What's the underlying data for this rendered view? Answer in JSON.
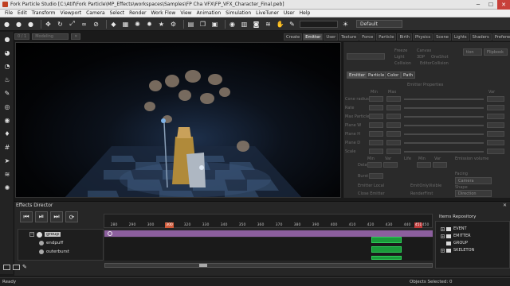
{
  "window": {
    "title": "Fork Particle Studio [C:\\Atif\\Fork Particle\\MP_Effects\\workspaces\\Samples\\FP Cha VFX\\FP_VFX_Character_Final.peb]",
    "minimize": "─",
    "maximize": "☐",
    "close": "✕"
  },
  "menu": [
    "File",
    "Edit",
    "Transform",
    "Viewport",
    "Camera",
    "Select",
    "Render",
    "Work Flow",
    "View",
    "Animation",
    "Simulation",
    "LiveTuner",
    "User",
    "Help"
  ],
  "toolbar": {
    "icons": [
      "blob-icon",
      "blob-icon",
      "blob-icon",
      "move-icon",
      "rotate-icon",
      "scale-icon",
      "link-icon",
      "unlink-icon",
      "shape-icon",
      "grid-icon",
      "burst-icon",
      "explode-icon",
      "star-icon",
      "settings-icon",
      "layers-icon",
      "copy-icon",
      "paste-icon",
      "eye-icon",
      "film-icon",
      "camera-icon",
      "wind-icon",
      "grab-icon",
      "wrench-icon"
    ],
    "preset_selected": "Default"
  },
  "subbar": {
    "frame_field": "0 / 1",
    "mode_select": "Modeling",
    "close_btn": "✕"
  },
  "property_tabs": [
    {
      "label": "Create",
      "active": false
    },
    {
      "label": "Emitter",
      "active": true
    },
    {
      "label": "User",
      "active": false
    },
    {
      "label": "Texture",
      "active": false
    },
    {
      "label": "Force",
      "active": false
    },
    {
      "label": "Particle",
      "active": false
    },
    {
      "label": "Birth",
      "active": false
    },
    {
      "label": "Physics",
      "active": false
    },
    {
      "label": "Scene",
      "active": false
    },
    {
      "label": "Lights",
      "active": false
    },
    {
      "label": "Shaders",
      "active": false
    },
    {
      "label": "Preferences",
      "active": false
    }
  ],
  "panel": {
    "top_buttons": [
      "tion",
      "Flipbook"
    ],
    "checks": [
      "Freeze",
      "Canvas",
      "Light",
      "3DP",
      "OneShot",
      "Collision",
      "EditorCollision"
    ],
    "sub_tabs": [
      "Emitter",
      "Particle",
      "Color",
      "Path"
    ],
    "section_title": "Emitter Properties",
    "col_headers": [
      "Min",
      "Max",
      "Var"
    ],
    "rows": [
      "Cone radius",
      "Rate",
      "Max Particle",
      "Plane W",
      "Plane H",
      "Plane D",
      "Scale"
    ],
    "lower_labels": [
      "Delay",
      "Min",
      "Var",
      "Life",
      "Min",
      "Var",
      "Burst",
      "Emitter Local",
      "EmitOnlyVisible",
      "Close Emitter",
      "RenderFirst"
    ],
    "lower_fields": [
      "Emission volume",
      "Facing",
      "Camera",
      "Shape",
      "Direction"
    ]
  },
  "effects_director": {
    "title": "Effects Director",
    "close": "✕",
    "transport": [
      "⏮",
      "⏯",
      "⏭",
      "⟳"
    ],
    "ruler_ticks": [
      "280",
      "290",
      "300",
      "310",
      "320",
      "330",
      "340",
      "350",
      "360",
      "370",
      "380",
      "390",
      "400",
      "410",
      "420",
      "430",
      "440",
      "450"
    ],
    "current_frame": "300",
    "end_frame": "451",
    "tracks": [
      {
        "label": "group",
        "highlight": true
      },
      {
        "label": "endpuff",
        "highlight": false
      },
      {
        "label": "outerburst",
        "highlight": false
      }
    ]
  },
  "items_repository": {
    "title": "Items Repository",
    "items": [
      {
        "label": "EVENT",
        "expander": "+"
      },
      {
        "label": "EMITTER",
        "expander": "+"
      },
      {
        "label": "GROUP",
        "expander": ""
      },
      {
        "label": "SKELETON",
        "expander": "+"
      }
    ]
  },
  "status": {
    "left": "Ready",
    "objects_selected": "Objects Selected: 0"
  }
}
